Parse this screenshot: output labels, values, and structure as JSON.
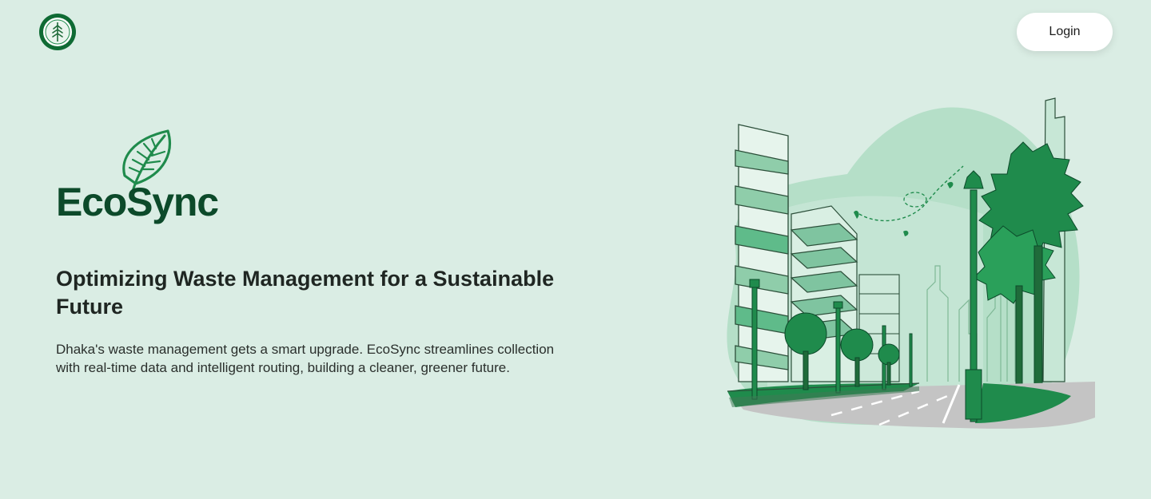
{
  "header": {
    "logo_icon": "leaf-emblem-icon",
    "login_label": "Login"
  },
  "brand": {
    "name": "EcoSync",
    "icon": "leaf-icon",
    "color": "#0c4a2a"
  },
  "hero": {
    "title": "Optimizing Waste Management for a Sustainable Future",
    "description": "Dhaka's waste management gets a smart upgrade. EcoSync streamlines collection with real-time data and intelligent routing, building a cleaner, greener future."
  },
  "illustration": {
    "subject": "green-city-street-illustration"
  },
  "colors": {
    "background": "#daede4",
    "accent": "#1f8b4c",
    "dark_green": "#0c4a2a",
    "button_bg": "#ffffff"
  }
}
